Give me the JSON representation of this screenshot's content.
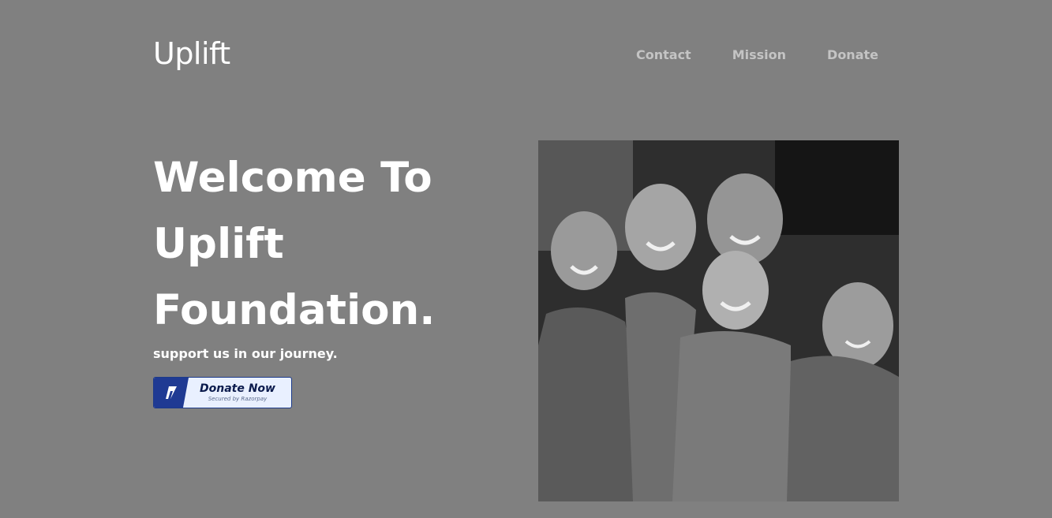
{
  "brand": {
    "name": "Uplift"
  },
  "nav": {
    "items": [
      {
        "label": "Contact"
      },
      {
        "label": "Mission"
      },
      {
        "label": "Donate"
      }
    ]
  },
  "hero": {
    "title_lines": [
      "Welcome To",
      "Uplift",
      "Foundation."
    ],
    "tagline": "support us in our journey."
  },
  "donate_button": {
    "label": "Donate Now",
    "sublabel": "Secured by Razorpay",
    "icon": "razorpay-logo-icon",
    "colors": {
      "brand": "#1f3a93",
      "background": "#e9f0ff"
    }
  },
  "image": {
    "style": "black-and-white photo of smiling children"
  },
  "colors": {
    "page_background": "#808080",
    "nav_text": "#c4c4c4",
    "text": "#ffffff"
  }
}
